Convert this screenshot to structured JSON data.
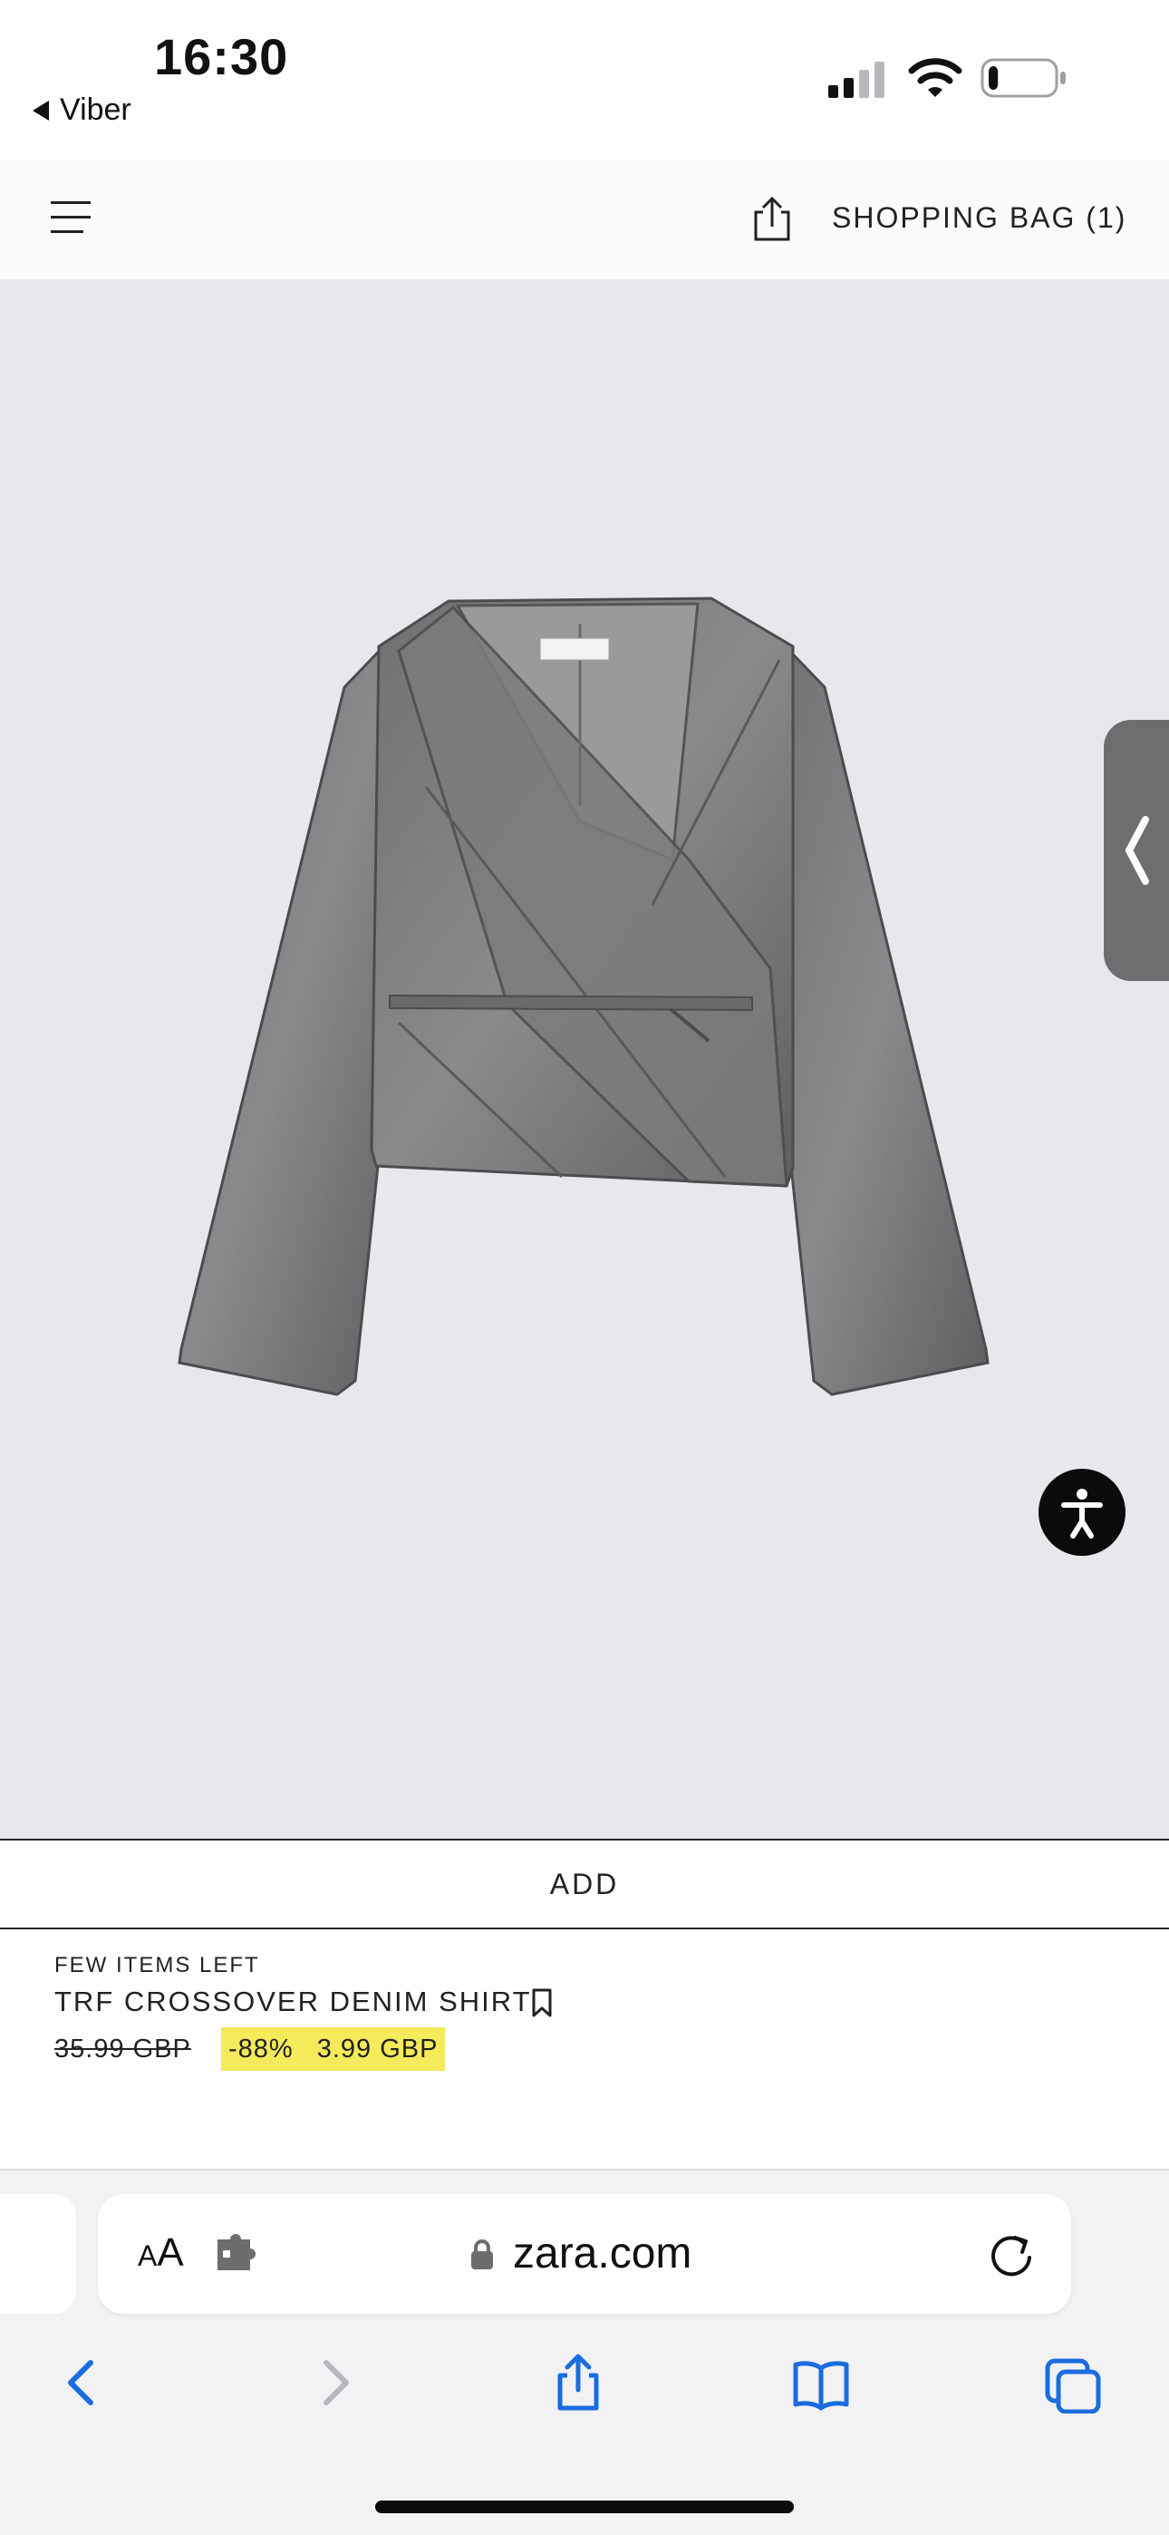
{
  "status_bar": {
    "time": "16:30",
    "back_app": "Viber",
    "icons": [
      "cellular-signal-icon",
      "wifi-icon",
      "battery-icon"
    ],
    "battery_level": 0.15
  },
  "header": {
    "menu_icon": "hamburger-menu-icon",
    "share_icon": "share-icon",
    "bag_label": "SHOPPING BAG (1)"
  },
  "product": {
    "image_alt": "grey denim crossover jacket",
    "add_label": "ADD",
    "stock_note": "FEW ITEMS LEFT",
    "name": "TRF CROSSOVER DENIM SHIRT",
    "old_price": "35.99 GBP",
    "discount": "-88%",
    "price": "3.99 GBP",
    "highlight_color": "#f4ea5a"
  },
  "floating": {
    "side_tab_icon": "chevron-left-icon",
    "accessibility_icon": "accessibility-icon"
  },
  "browser": {
    "text_size_label_small": "A",
    "text_size_label_large": "A",
    "extension_icon": "puzzle-piece-icon",
    "lock_icon": "lock-icon",
    "url": "zara.com",
    "reload_icon": "reload-icon",
    "toolbar": [
      "back-icon",
      "forward-icon",
      "share-icon",
      "bookmarks-icon",
      "tabs-icon"
    ],
    "accent_color": "#1a6cdf"
  }
}
